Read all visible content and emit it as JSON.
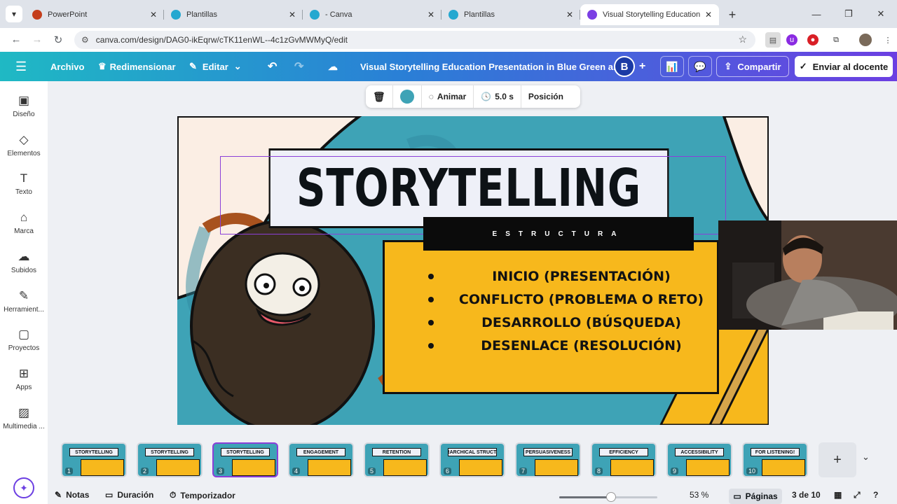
{
  "browser": {
    "tabs": [
      {
        "title": "PowerPoint",
        "icon": "powerpoint-icon",
        "color": "#c43e1c"
      },
      {
        "title": "Plantillas",
        "icon": "canva-icon",
        "color": "#25a8d0"
      },
      {
        "title": "- Canva",
        "icon": "canva-icon",
        "color": "#25a8d0"
      },
      {
        "title": "Plantillas",
        "icon": "canva-icon",
        "color": "#25a8d0"
      },
      {
        "title": "Visual Storytelling Education Pre",
        "icon": "canva-slides-icon",
        "color": "#7b3fe4"
      }
    ],
    "url": "canva.com/design/DAG0-ikEqrw/cTK11enWL--4c1zGvMWMyQ/edit"
  },
  "toolbar": {
    "archivo": "Archivo",
    "redimensionar": "Redimensionar",
    "editar": "Editar",
    "doc_title": "Visual Storytelling Education Presentation in Blue Green a...",
    "avatar_letter": "B",
    "share": "Compartir",
    "send": "Enviar al docente"
  },
  "sidebar": {
    "items": [
      {
        "label": "Diseño",
        "icon": "design-icon"
      },
      {
        "label": "Elementos",
        "icon": "elements-icon"
      },
      {
        "label": "Texto",
        "icon": "text-icon"
      },
      {
        "label": "Marca",
        "icon": "brand-icon"
      },
      {
        "label": "Subidos",
        "icon": "upload-icon"
      },
      {
        "label": "Herramient...",
        "icon": "tools-icon"
      },
      {
        "label": "Proyectos",
        "icon": "folder-icon"
      },
      {
        "label": "Apps",
        "icon": "apps-icon"
      },
      {
        "label": "Multimedia ...",
        "icon": "media-icon"
      }
    ]
  },
  "context_toolbar": {
    "color": "#3ea3b6",
    "animate": "Animar",
    "duration": "5.0 s",
    "position": "Posición"
  },
  "slide": {
    "title": "STORYTELLING",
    "subtitle": "ESTRUCTURA",
    "bullets": [
      "INICIO (PRESENTACIÓN)",
      "CONFLICTO (PROBLEMA O RETO)",
      "DESARROLLO (BÚSQUEDA)",
      "DESENLACE (RESOLUCIÓN)"
    ]
  },
  "thumbnails": [
    {
      "num": "1",
      "title": "STORYTELLING"
    },
    {
      "num": "2",
      "title": "STORYTELLING"
    },
    {
      "num": "3",
      "title": "STORYTELLING",
      "selected": true
    },
    {
      "num": "4",
      "title": "ENGAGEMENT"
    },
    {
      "num": "5",
      "title": "RETENTION"
    },
    {
      "num": "6",
      "title": "HIERARCHICAL STRUCTURE"
    },
    {
      "num": "7",
      "title": "PERSUASIVENESS"
    },
    {
      "num": "8",
      "title": "EFFICIENCY"
    },
    {
      "num": "9",
      "title": "ACCESSIBILITY"
    },
    {
      "num": "10",
      "title": "FOR LISTENING!"
    }
  ],
  "bottom": {
    "notes": "Notas",
    "duration": "Duración",
    "timer": "Temporizador",
    "zoom": "53 %",
    "zoom_fraction": 0.53,
    "pages": "Páginas",
    "page_count": "3 de 10"
  }
}
